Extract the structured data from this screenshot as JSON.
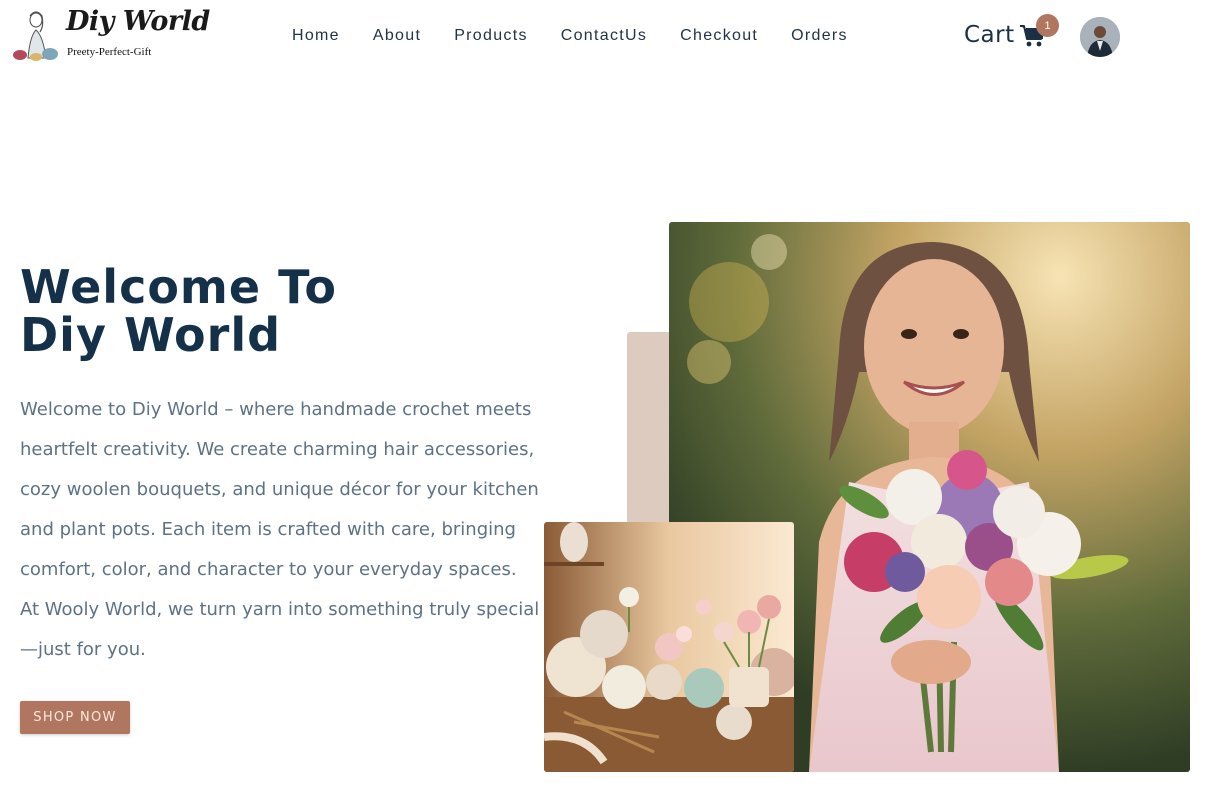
{
  "logo": {
    "title": "Diy World",
    "tagline": "Preety-Perfect-Gift"
  },
  "nav": {
    "items": [
      {
        "label": "Home"
      },
      {
        "label": "About"
      },
      {
        "label": "Products"
      },
      {
        "label": "ContactUs"
      },
      {
        "label": "Checkout"
      },
      {
        "label": "Orders"
      }
    ]
  },
  "cart": {
    "label": "Cart",
    "count": "1",
    "icon": "shopping-cart-icon"
  },
  "hero": {
    "title_line1": "Welcome To",
    "title_line2": "Diy World",
    "description": "Welcome to Diy World – where handmade crochet meets heartfelt creativity. We create charming hair accessories, cozy woolen bouquets, and unique décor for your kitchen and plant pots. Each item is crafted with care, bringing comfort, color, and character to your everyday spaces. At Wooly World, we turn yarn into something truly special—just for you.",
    "button_label": "SHOP NOW"
  },
  "colors": {
    "accent": "#b07660",
    "heading": "#15314a",
    "body_text": "#5e7286",
    "deco_block": "#decbbf"
  }
}
